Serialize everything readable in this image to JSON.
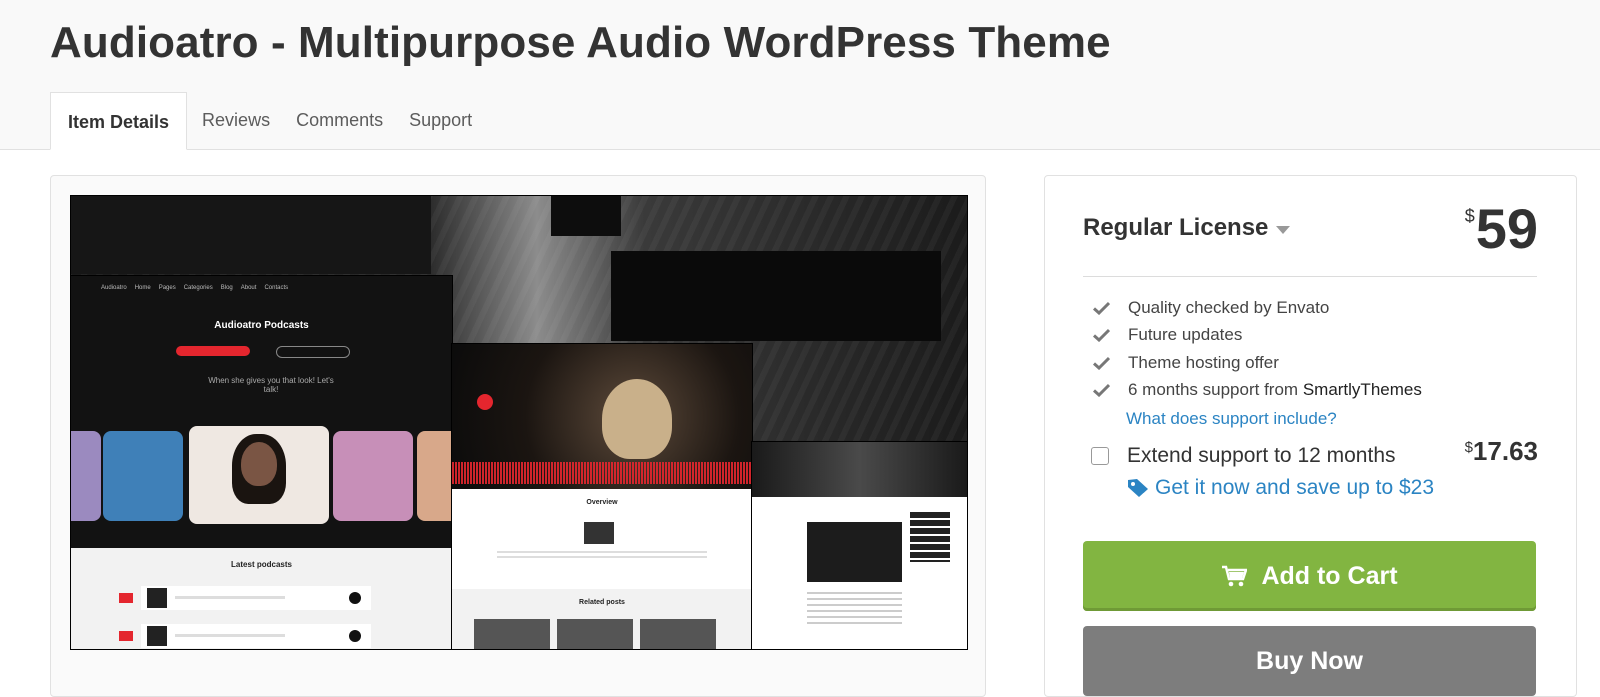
{
  "header": {
    "title": "Audioatro - Multipurpose Audio WordPress Theme",
    "tabs": [
      {
        "label": "Item Details",
        "active": true
      },
      {
        "label": "Reviews"
      },
      {
        "label": "Comments"
      },
      {
        "label": "Support"
      }
    ]
  },
  "preview": {
    "shot1": {
      "nav": [
        "Audioatro",
        "Home",
        "Pages",
        "Categories",
        "Blog",
        "About",
        "Contacts"
      ],
      "title": "Audioatro Podcasts",
      "tagline": "When she gives you that look! Let's talk!",
      "section_title": "Latest podcasts"
    },
    "shot2": {
      "section_title": "Overview",
      "related_title": "Related posts"
    }
  },
  "purchase": {
    "license": "Regular License",
    "currency_symbol": "$",
    "price": "59",
    "features": [
      {
        "text": "Quality checked by Envato"
      },
      {
        "text": "Future updates"
      },
      {
        "text": "Theme hosting offer"
      },
      {
        "text": "6 months support from ",
        "author": "SmartlyThemes"
      }
    ],
    "support_link": "What does support include?",
    "extend_label": "Extend support to 12 months",
    "extend_checked": false,
    "extend_price": "17.63",
    "save_text": "Get it now and save up to $23",
    "add_to_cart": "Add to Cart",
    "buy_now": "Buy Now"
  },
  "colors": {
    "green": "#82b541",
    "link": "#2b84c3",
    "gray_button": "#7d7d7d",
    "accent_red": "#e4262e"
  },
  "icons": {
    "check": "check-icon",
    "license_caret": "caret-down-icon",
    "tag": "tag-icon",
    "cart": "cart-icon"
  }
}
